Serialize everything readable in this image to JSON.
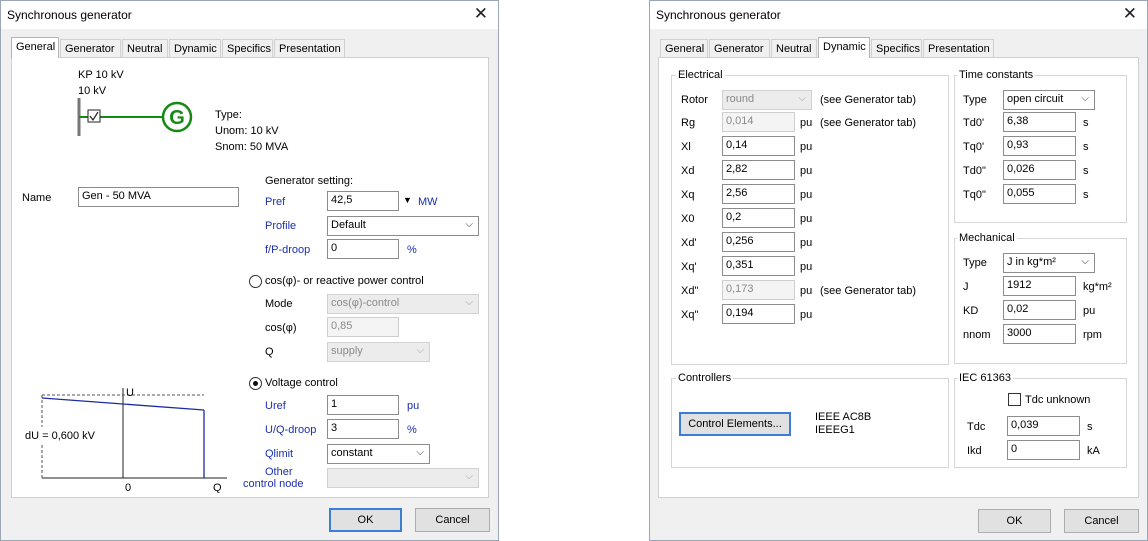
{
  "left_dialog": {
    "title": "Synchronous generator",
    "tabs": [
      "General",
      "Generator",
      "Neutral",
      "Dynamic",
      "Specifics",
      "Presentation"
    ],
    "active_tab": "General",
    "diagram": {
      "node_name": "KP 10 kV",
      "node_voltage": "10 kV",
      "symbol": "G",
      "type_label": "Type:",
      "unom": "Unom: 10 kV",
      "snom": "Snom: 50 MVA"
    },
    "name_label": "Name",
    "name_value": "Gen - 50 MVA",
    "generator_setting": {
      "heading": "Generator setting:",
      "pref_label": "Pref",
      "pref_value": "42,5",
      "pref_unit": "MW",
      "profile_label": "Profile",
      "profile_value": "Default",
      "droop_label": "f/P-droop",
      "droop_value": "0",
      "droop_unit": "%"
    },
    "cos_control": {
      "label": "cos(φ)- or reactive power control",
      "mode_label": "Mode",
      "mode_value": "cos(φ)-control",
      "cos_label": "cos(φ)",
      "cos_value": "0,85",
      "q_label": "Q",
      "q_value": "supply"
    },
    "voltage_control": {
      "label": "Voltage control",
      "uref_label": "Uref",
      "uref_value": "1",
      "uref_unit": "pu",
      "uq_label": "U/Q-droop",
      "uq_value": "3",
      "uq_unit": "%",
      "qlimit_label": "Qlimit",
      "qlimit_value": "constant",
      "other_label_1": "Other",
      "other_label_2": "control node",
      "other_value": ""
    },
    "qu_chart": {
      "u_axis": "U",
      "q_axis": "Q",
      "zero": "0",
      "du_label": "dU =  0,600 kV"
    },
    "ok": "OK",
    "cancel": "Cancel"
  },
  "right_dialog": {
    "title": "Synchronous generator",
    "tabs": [
      "General",
      "Generator",
      "Neutral",
      "Dynamic",
      "Specifics",
      "Presentation"
    ],
    "active_tab": "Dynamic",
    "electrical": {
      "heading": "Electrical",
      "rotor_label": "Rotor",
      "rotor_value": "round",
      "see_gen": "(see Generator tab)",
      "rows": [
        {
          "label": "Rg",
          "value": "0,014",
          "unit": "pu",
          "note": "(see Generator tab)",
          "disabled": true
        },
        {
          "label": "Xl",
          "value": "0,14",
          "unit": "pu",
          "note": "",
          "disabled": false
        },
        {
          "label": "Xd",
          "value": "2,82",
          "unit": "pu",
          "note": "",
          "disabled": false
        },
        {
          "label": "Xq",
          "value": "2,56",
          "unit": "pu",
          "note": "",
          "disabled": false
        },
        {
          "label": "X0",
          "value": "0,2",
          "unit": "pu",
          "note": "",
          "disabled": false
        },
        {
          "label": "Xd'",
          "value": "0,256",
          "unit": "pu",
          "note": "",
          "disabled": false
        },
        {
          "label": "Xq'",
          "value": "0,351",
          "unit": "pu",
          "note": "",
          "disabled": false
        },
        {
          "label": "Xd\"",
          "value": "0,173",
          "unit": "pu",
          "note": "(see Generator tab)",
          "disabled": true
        },
        {
          "label": "Xq\"",
          "value": "0,194",
          "unit": "pu",
          "note": "",
          "disabled": false
        }
      ]
    },
    "time_constants": {
      "heading": "Time constants",
      "type_label": "Type",
      "type_value": "open circuit",
      "rows": [
        {
          "label": "Td0'",
          "value": "6,38",
          "unit": "s"
        },
        {
          "label": "Tq0'",
          "value": "0,93",
          "unit": "s"
        },
        {
          "label": "Td0\"",
          "value": "0,026",
          "unit": "s"
        },
        {
          "label": "Tq0\"",
          "value": "0,055",
          "unit": "s"
        }
      ]
    },
    "mechanical": {
      "heading": "Mechanical",
      "type_label": "Type",
      "type_value": "J in kg*m²",
      "rows": [
        {
          "label": "J",
          "value": "1912",
          "unit": "kg*m²"
        },
        {
          "label": "KD",
          "value": "0,02",
          "unit": "pu"
        },
        {
          "label": "nnom",
          "value": "3000",
          "unit": "rpm"
        }
      ]
    },
    "controllers": {
      "heading": "Controllers",
      "button": "Control Elements...",
      "items": [
        "IEEE AC8B",
        "IEEEG1"
      ]
    },
    "iec": {
      "heading": "IEC 61363",
      "tdc_unknown": "Tdc unknown",
      "tdc_label": "Tdc",
      "tdc_value": "0,039",
      "tdc_unit": "s",
      "ikd_label": "Ikd",
      "ikd_value": "0",
      "ikd_unit": "kA"
    },
    "ok": "OK",
    "cancel": "Cancel"
  },
  "colors": {
    "generator_green": "#138a13",
    "label_blue": "#1a2fb0",
    "chart_line": "#1d2ba0"
  }
}
